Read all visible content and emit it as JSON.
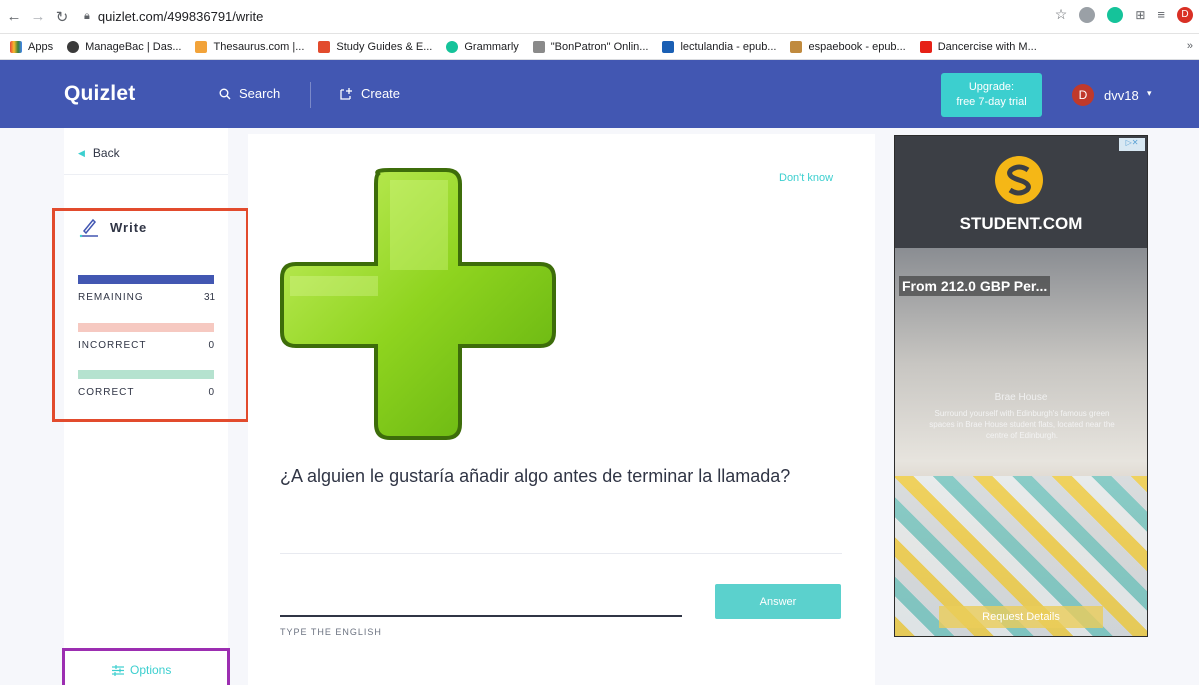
{
  "browser": {
    "url": "quizlet.com/499836791/write",
    "bookmarks": [
      {
        "label": "Apps",
        "color": "#e8453c"
      },
      {
        "label": "ManageBac | Das...",
        "color": "#3a3a3a"
      },
      {
        "label": "Thesaurus.com |...",
        "color": "#f2a33a"
      },
      {
        "label": "Study Guides & E...",
        "color": "#e24b2d"
      },
      {
        "label": "Grammarly",
        "color": "#15c39a"
      },
      {
        "label": "\"BonPatron\" Onlin...",
        "color": "#8a8a8a"
      },
      {
        "label": "lectulandia - epub...",
        "color": "#1a5fb4"
      },
      {
        "label": "espaebook - epub...",
        "color": "#c08a3e"
      },
      {
        "label": "Dancercise with M...",
        "color": "#e62117"
      }
    ],
    "more": "»",
    "avatar_letter": "D"
  },
  "header": {
    "logo": "Quizlet",
    "search_label": "Search",
    "create_label": "Create",
    "upgrade_line1": "Upgrade:",
    "upgrade_line2": "free 7-day trial",
    "avatar_letter": "D",
    "username": "dvv18",
    "caret": "▾"
  },
  "sidebar": {
    "back_label": "Back",
    "mode_title": "Write",
    "stats": [
      {
        "label": "REMAINING",
        "value": "31",
        "color": "#4257b2"
      },
      {
        "label": "INCORRECT",
        "value": "0",
        "color": "#f6c9c1"
      },
      {
        "label": "CORRECT",
        "value": "0",
        "color": "#b5e2cf"
      }
    ],
    "options_label": "Options"
  },
  "card": {
    "dont_know": "Don't know",
    "question": "¿A alguien le gustaría añadir algo antes de terminar la llamada?",
    "answer_placeholder": "",
    "answer_hint": "TYPE THE ENGLISH",
    "answer_button": "Answer"
  },
  "ad": {
    "brand": "STUDENT.COM",
    "price": "From 212.0 GBP Per...",
    "house_title": "Brae House",
    "description": "Surround yourself with Edinburgh's famous green spaces in Brae House student flats, located near the centre of Edinburgh.",
    "cta": "Request Details"
  },
  "colors": {
    "brand_blue": "#4257b2",
    "accent_teal": "#3ccfcf",
    "highlight_red": "#e24b2d",
    "highlight_purple": "#9c2eb1"
  }
}
